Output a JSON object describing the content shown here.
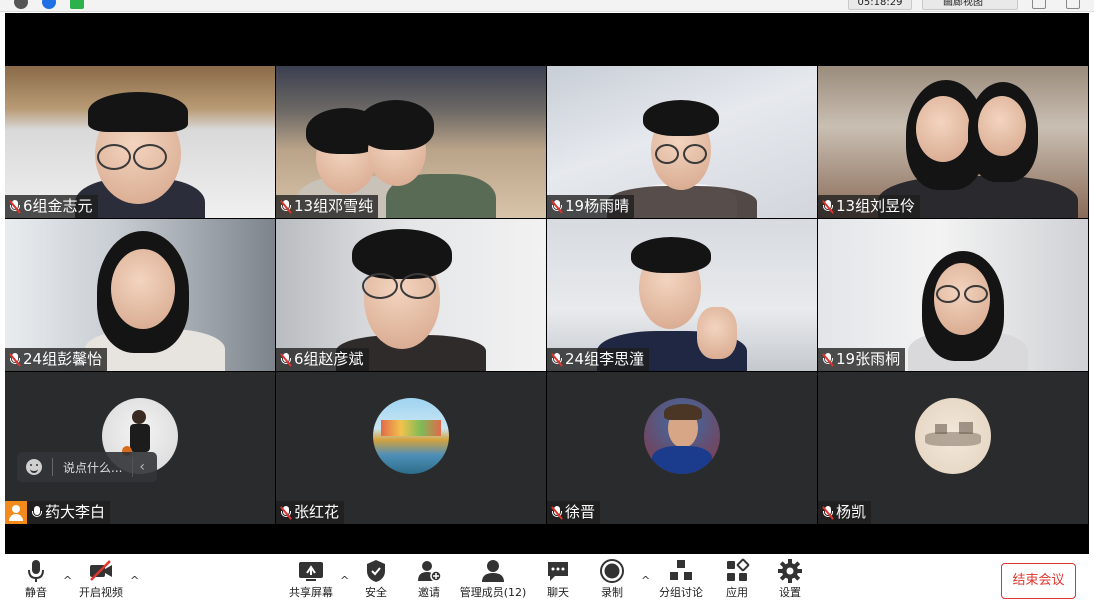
{
  "window": {
    "timer": "05:18:29",
    "view_mode": "画廊视图"
  },
  "participants": [
    {
      "name": "6组金志元",
      "muted": true,
      "video": true
    },
    {
      "name": "13组邓雪纯",
      "muted": true,
      "video": true
    },
    {
      "name": "19杨雨晴",
      "muted": true,
      "video": true
    },
    {
      "name": "13组刘昱伶",
      "muted": true,
      "video": true
    },
    {
      "name": "24组彭馨怡",
      "muted": true,
      "video": true
    },
    {
      "name": "6组赵彦斌",
      "muted": true,
      "video": true
    },
    {
      "name": "24组李思潼",
      "muted": true,
      "video": true
    },
    {
      "name": "19张雨桐",
      "muted": true,
      "video": true
    },
    {
      "name": "药大李白",
      "muted": false,
      "video": false,
      "host": true
    },
    {
      "name": "张红花",
      "muted": true,
      "video": false
    },
    {
      "name": "徐晋",
      "muted": true,
      "video": false
    },
    {
      "name": "杨凯",
      "muted": true,
      "video": false
    }
  ],
  "chat_input": {
    "placeholder": "说点什么...",
    "chevron": "‹"
  },
  "toolbar": {
    "mute": "静音",
    "start_video": "开启视频",
    "share_screen": "共享屏幕",
    "security": "安全",
    "invite": "邀请",
    "manage_participants": "管理成员(12)",
    "chat": "聊天",
    "record": "录制",
    "breakout_rooms": "分组讨论",
    "apps": "应用",
    "settings": "设置",
    "end_meeting": "结束会议",
    "caret": "^"
  },
  "colors": {
    "accent_red": "#e0352f",
    "host_orange": "#f28a1c",
    "tile_dark": "#2a2b2d"
  }
}
